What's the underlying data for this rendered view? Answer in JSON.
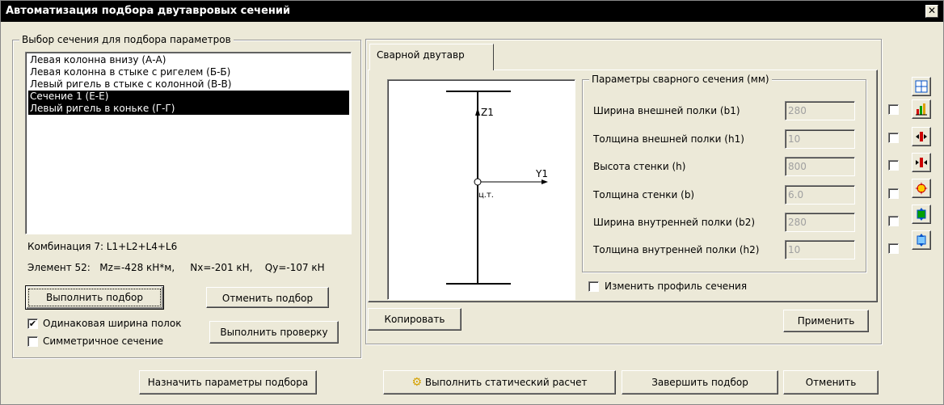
{
  "window": {
    "title": "Автоматизация подбора двутавровых сечений",
    "close_glyph": "✕"
  },
  "selection_group": {
    "legend": "Выбор сечения для подбора параметров",
    "items": [
      {
        "label": "Левая колонна внизу (А-А)",
        "selected": false
      },
      {
        "label": "Левая колонна в стыке с ригелем (Б-Б)",
        "selected": false
      },
      {
        "label": "Левый ригель в стыке с колонной (В-В)",
        "selected": false
      },
      {
        "label": "Сечение 1 (Е-Е)",
        "selected": true
      },
      {
        "label": "Левый ригель в коньке (Г-Г)",
        "selected": true
      }
    ],
    "combination": "Комбинация 7: L1+L2+L4+L6",
    "element": "Элемент 52:   Mz=-428 кН*м,     Nx=-201 кН,    Qy=-107 кН",
    "run_button": "Выполнить подбор",
    "cancel_button": "Отменить подбор",
    "check_button": "Выполнить проверку",
    "same_width_label": "Одинаковая ширина полок",
    "same_width_checked": true,
    "symmetric_label": "Симметричное сечение",
    "symmetric_checked": false
  },
  "tab": {
    "label": "Сварной двутавр"
  },
  "diagram": {
    "z_label": "Z1",
    "y_label": "Y1",
    "center_label": "ц.т."
  },
  "params": {
    "legend": "Параметры сварного сечения (мм)",
    "rows": [
      {
        "label": "Ширина внешней полки (b1)",
        "value": "280"
      },
      {
        "label": "Толщина внешней полки (h1)",
        "value": "10"
      },
      {
        "label": "Высота стенки  (h)",
        "value": "800"
      },
      {
        "label": "Толщина стенки (b)",
        "value": "6.0"
      },
      {
        "label": "Ширина внутренней полки (b2)",
        "value": "280"
      },
      {
        "label": "Толщина внутренней полки (h2)",
        "value": "10"
      }
    ],
    "change_profile_label": "Изменить профиль сечения",
    "copy_button": "Копировать",
    "apply_button": "Применить"
  },
  "toolbar": {
    "icons": [
      "grid-icon",
      "bar-chart-icon",
      "arrows-out-icon",
      "arrows-in-icon",
      "star-burst-icon",
      "stress-up-icon",
      "stress-down-icon"
    ]
  },
  "footer": {
    "assign_button": "Назначить параметры подбора",
    "static_button": "Выполнить статический расчет",
    "finish_button": "Завершить подбор",
    "cancel_button": "Отменить"
  }
}
